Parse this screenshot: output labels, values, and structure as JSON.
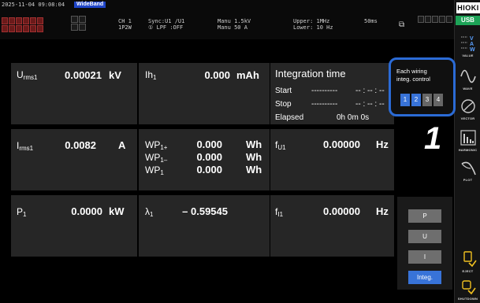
{
  "status": {
    "datetime": "2025-11-04 09:08:04",
    "bandwidth": "WideBand",
    "channel": "CH 1",
    "wiring": "1P2W",
    "sync": "Sync:U1  /U1",
    "lpf": "① LPF :OFF",
    "manu_u": "Manu 1.5kV",
    "manu_i": "Manu  50 A",
    "upper": "Upper:  1MHz",
    "lower": "Lower: 10 Hz",
    "interval": "50ms"
  },
  "sidebar": {
    "brand": "HIOKI",
    "usb": "USB",
    "items": [
      {
        "label": "VALUE",
        "icon": "value-icon"
      },
      {
        "label": "WAVE",
        "icon": "wave-icon"
      },
      {
        "label": "VECTOR",
        "icon": "vector-icon"
      },
      {
        "label": "HARMONIC",
        "icon": "harmonic-icon"
      },
      {
        "label": "PLOT",
        "icon": "plot-icon"
      },
      {
        "label": "EJECT",
        "icon": "eject-icon"
      },
      {
        "label": "SHUTDOWN",
        "icon": "shutdown-icon"
      }
    ]
  },
  "panels": {
    "urms": {
      "label": "U",
      "sub": "rms1",
      "value": "0.00021",
      "unit": "kV"
    },
    "ih": {
      "label": "Ih",
      "sub": "1",
      "value": "0.000",
      "unit": "mAh"
    },
    "irms": {
      "label": "I",
      "sub": "rms1",
      "value": "0.0082",
      "unit": "A"
    },
    "wp": [
      {
        "label": "WP",
        "sub": "1+",
        "value": "0.000",
        "unit": "Wh"
      },
      {
        "label": "WP",
        "sub": "1–",
        "value": "0.000",
        "unit": "Wh"
      },
      {
        "label": "WP",
        "sub": "1",
        "value": "0.000",
        "unit": "Wh"
      }
    ],
    "fu": {
      "label": "f",
      "sub": "U1",
      "value": "0.00000",
      "unit": "Hz"
    },
    "p": {
      "label": "P",
      "sub": "1",
      "value": "0.0000",
      "unit": "kW"
    },
    "lambda": {
      "label": "λ",
      "sub": "1",
      "value": "– 0.59545",
      "unit": ""
    },
    "fi": {
      "label": "f",
      "sub": "I1",
      "value": "0.00000",
      "unit": "Hz"
    }
  },
  "integration": {
    "title": "Integration time",
    "start_label": "Start",
    "start_dashes": "----------",
    "start_value": "-- : -- : --",
    "stop_label": "Stop",
    "stop_dashes": "----------",
    "stop_value": "-- : -- : --",
    "elapsed_label": "Elapsed",
    "elapsed_value": "0h  0m  0s"
  },
  "wiring_control": {
    "line1": "Each wiring",
    "line2": "integ. control",
    "buttons": [
      "1",
      "2",
      "3",
      "4"
    ],
    "active": [
      true,
      true,
      false,
      false
    ]
  },
  "callout": "1",
  "selector": {
    "buttons": [
      "P",
      "U",
      "I",
      "Integ."
    ],
    "active": "Integ."
  }
}
